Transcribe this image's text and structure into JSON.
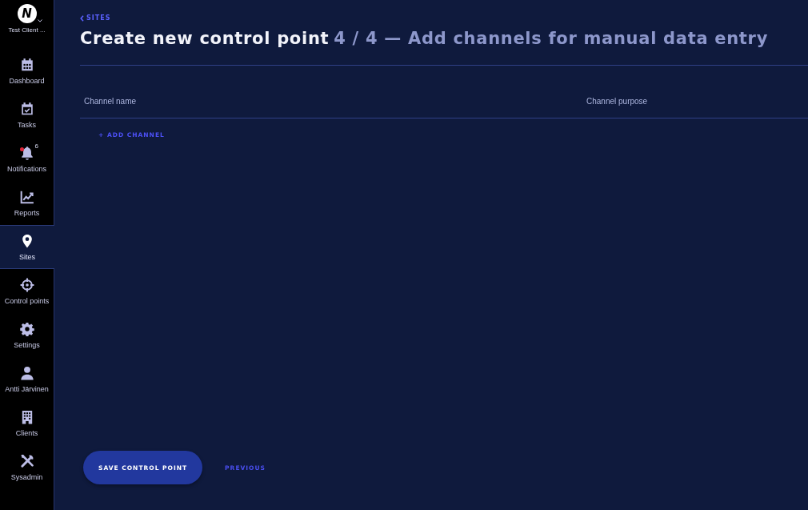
{
  "sidebar": {
    "client": {
      "logo_text": "N",
      "label": "Test Client ..."
    },
    "items": [
      {
        "kind": "dashboard",
        "label": "Dashboard",
        "selected": false
      },
      {
        "kind": "tasks",
        "label": "Tasks",
        "selected": false
      },
      {
        "kind": "notifications",
        "label": "Notifications",
        "badge": "6",
        "selected": false
      },
      {
        "kind": "reports",
        "label": "Reports",
        "selected": false
      },
      {
        "kind": "sites",
        "label": "Sites",
        "selected": true
      },
      {
        "kind": "controlpoints",
        "label": "Control points",
        "selected": false
      },
      {
        "kind": "settings",
        "label": "Settings",
        "selected": false
      },
      {
        "kind": "profile",
        "label": "Antti Järvinen",
        "selected": false
      },
      {
        "kind": "clients",
        "label": "Clients",
        "selected": false
      },
      {
        "kind": "sysadmin",
        "label": "Sysadmin",
        "selected": false
      }
    ]
  },
  "header": {
    "back_link": "SITES",
    "title": "Create new control point",
    "step": "4 / 4 — Add channels for manual data entry"
  },
  "table": {
    "columns": [
      "Channel name",
      "Channel purpose"
    ],
    "add_button": "+ ADD CHANNEL"
  },
  "footer": {
    "buttons": [
      {
        "kind": "primary",
        "label": "SAVE CONTROL POINT"
      },
      {
        "kind": "link",
        "label": "PREVIOUS"
      }
    ]
  }
}
